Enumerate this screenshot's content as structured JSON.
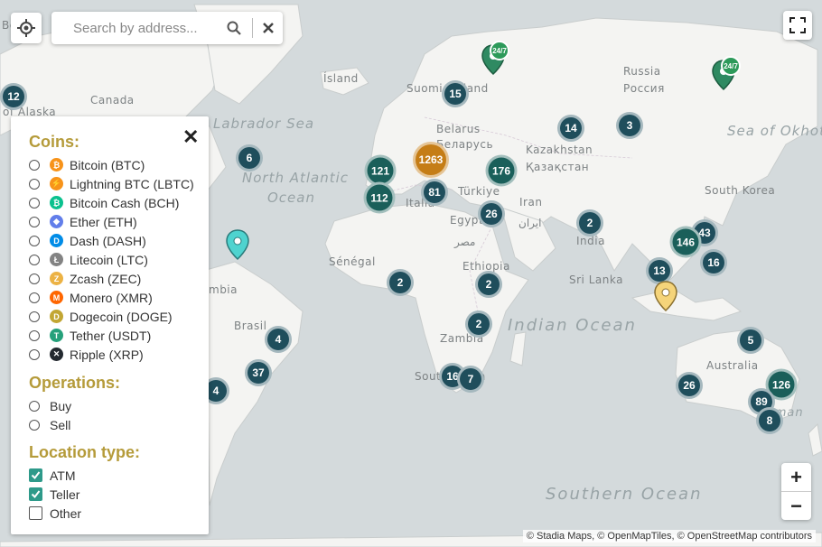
{
  "search": {
    "placeholder": "Search by address..."
  },
  "map": {
    "land_labels": [
      "Ísland",
      "Suomi Finland",
      "Russia",
      "Россия",
      "Canada",
      "Belarus",
      "Беларусь",
      "Kazakhstan",
      "Қазақстан",
      "Türkiye",
      "Iran",
      "ایران",
      "Egypt",
      "مصر",
      "South Korea",
      "India",
      "Sénégal",
      "Ethiopia",
      "Sri Lanka",
      "Brasil",
      "Zambia",
      "South Africa",
      "Australia",
      "Italia",
      "of Alaska",
      "Be",
      "mbia",
      "sman"
    ],
    "ocean_labels": [
      "Labrador Sea",
      "North Atlantic",
      "Ocean",
      "Sea of Okhotsk",
      "Indian Ocean",
      "Southern Ocean"
    ],
    "clusters": [
      {
        "label": "12",
        "color": "#1f4e5c"
      },
      {
        "label": "15",
        "color": "#1f4e5c"
      },
      {
        "label": "14",
        "color": "#1f4e5c"
      },
      {
        "label": "3",
        "color": "#1f4e5c"
      },
      {
        "label": "6",
        "color": "#1f4e5c"
      },
      {
        "label": "121",
        "color": "#1a5f5a"
      },
      {
        "label": "1263",
        "color": "#c57d16"
      },
      {
        "label": "176",
        "color": "#1a5f5a"
      },
      {
        "label": "112",
        "color": "#1a5f5a"
      },
      {
        "label": "81",
        "color": "#1f4e5c"
      },
      {
        "label": "26",
        "color": "#1f4e5c"
      },
      {
        "label": "2",
        "color": "#1f4e5c"
      },
      {
        "label": "43",
        "color": "#1f4e5c"
      },
      {
        "label": "146",
        "color": "#1a5f5a"
      },
      {
        "label": "16",
        "color": "#1f4e5c"
      },
      {
        "label": "13",
        "color": "#1f4e5c"
      },
      {
        "label": "2",
        "color": "#1f4e5c"
      },
      {
        "label": "2",
        "color": "#1f4e5c"
      },
      {
        "label": "2",
        "color": "#1f4e5c"
      },
      {
        "label": "4",
        "color": "#1f4e5c"
      },
      {
        "label": "37",
        "color": "#1f4e5c"
      },
      {
        "label": "4",
        "color": "#1f4e5c"
      },
      {
        "label": "16",
        "color": "#1f4e5c"
      },
      {
        "label": "7",
        "color": "#1f4e5c"
      },
      {
        "label": "5",
        "color": "#1f4e5c"
      },
      {
        "label": "26",
        "color": "#1f4e5c"
      },
      {
        "label": "126",
        "color": "#1a5f5a"
      },
      {
        "label": "89",
        "color": "#1f4e5c"
      },
      {
        "label": "8",
        "color": "#1f4e5c"
      }
    ],
    "badge_text": "24/7",
    "attribution": "© Stadia Maps, © OpenMapTiles, © OpenStreetMap contributors"
  },
  "zoom": {
    "in": "+",
    "out": "−"
  },
  "filter": {
    "coins_title": "Coins:",
    "coins": [
      {
        "label": "Bitcoin (BTC)",
        "color": "#f7931a",
        "glyph": "₿"
      },
      {
        "label": "Lightning BTC (LBTC)",
        "color": "#f7931a",
        "glyph": "⚡"
      },
      {
        "label": "Bitcoin Cash (BCH)",
        "color": "#0ac18e",
        "glyph": "₿"
      },
      {
        "label": "Ether (ETH)",
        "color": "#627eea",
        "glyph": "◆"
      },
      {
        "label": "Dash (DASH)",
        "color": "#008ce7",
        "glyph": "D"
      },
      {
        "label": "Litecoin (LTC)",
        "color": "#838383",
        "glyph": "Ł"
      },
      {
        "label": "Zcash (ZEC)",
        "color": "#ecb244",
        "glyph": "Z"
      },
      {
        "label": "Monero (XMR)",
        "color": "#ff6600",
        "glyph": "M"
      },
      {
        "label": "Dogecoin (DOGE)",
        "color": "#c2a633",
        "glyph": "D"
      },
      {
        "label": "Tether (USDT)",
        "color": "#26a17b",
        "glyph": "T"
      },
      {
        "label": "Ripple (XRP)",
        "color": "#23292f",
        "glyph": "✕"
      }
    ],
    "operations_title": "Operations:",
    "operations": [
      "Buy",
      "Sell"
    ],
    "location_title": "Location type:",
    "locations": [
      {
        "label": "ATM",
        "checked": true
      },
      {
        "label": "Teller",
        "checked": true
      },
      {
        "label": "Other",
        "checked": false
      }
    ]
  }
}
